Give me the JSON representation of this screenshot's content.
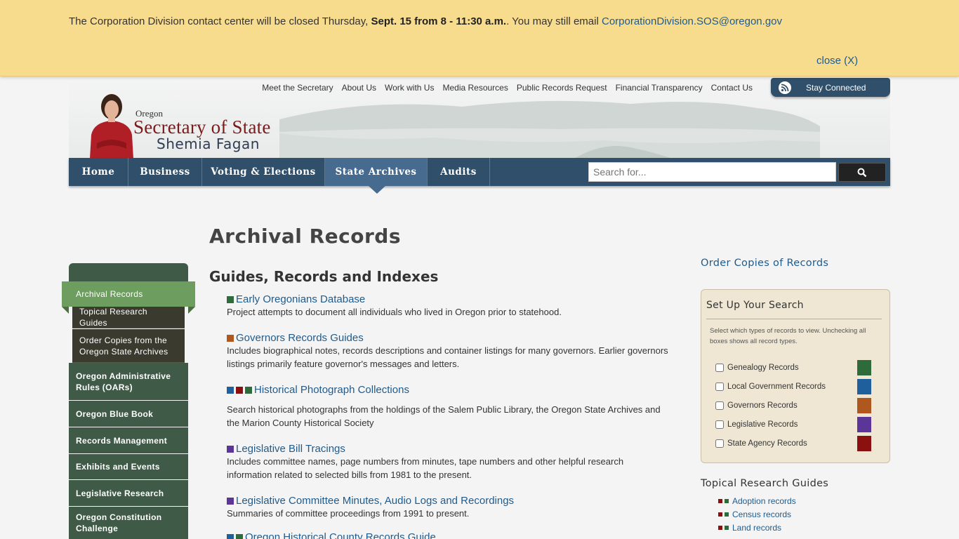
{
  "alert": {
    "text_before": "The Corporation Division contact center will be closed Thursday, ",
    "text_bold": "Sept. 15 from 8 - 11:30 a.m.",
    "text_after": ". You may still email ",
    "email": "CorporationDivision.SOS@oregon.gov",
    "close_label": "close (X)"
  },
  "header": {
    "top_links": [
      "Meet the Secretary",
      "About Us",
      "Work with Us",
      "Media Resources",
      "Public Records Request",
      "Financial Transparency",
      "Contact Us"
    ],
    "stay_connected": "Stay Connected",
    "logo": {
      "state": "Oregon",
      "title": "Secretary of State",
      "name": "Shemia Fagan"
    }
  },
  "nav": {
    "items": [
      "Home",
      "Business",
      "Voting & Elections",
      "State Archives",
      "Audits"
    ],
    "active": "State Archives",
    "search_placeholder": "Search for..."
  },
  "sidebar": {
    "active": "Archival Records",
    "sub_items": [
      "Topical Research Guides",
      "Order Copies from the Oregon State Archives"
    ],
    "items": [
      "Oregon Administrative Rules (OARs)",
      "Oregon Blue Book",
      "Records Management",
      "Exhibits and Events",
      "Legislative Research",
      "Oregon Constitution Challenge"
    ]
  },
  "main": {
    "title": "Archival Records",
    "section_title": "Guides, Records and Indexes",
    "entries": [
      {
        "title": "Early Oregonians Database",
        "desc": "Project attempts to document all individuals who lived in Oregon prior to statehood.",
        "colors": [
          "#2e6b3a"
        ]
      },
      {
        "title": "Governors Records Guides",
        "desc": "Includes biographical notes, records descriptions and container listings for many governors. Earlier governors listings primarily feature governor's messages and letters.",
        "colors": [
          "#b0571f"
        ]
      },
      {
        "title": "Historical Photograph Collections",
        "desc": "Search historical photographs from the holdings of the Salem Public Library, the Oregon State Archives and the Marion County Historical Society",
        "colors": [
          "#1f5f9c",
          "#8b1111",
          "#2e6b3a"
        ]
      },
      {
        "title": "Legislative Bill Tracings",
        "desc": "Includes committee names, page numbers from minutes, tape numbers and other helpful research information related to selected bills from 1981 to the present.",
        "colors": [
          "#5b3597"
        ]
      },
      {
        "title": "Legislative Committee Minutes, Audio Logs and Recordings",
        "desc": "Summaries of committee proceedings from 1991 to present.",
        "colors": [
          "#5b3597"
        ]
      },
      {
        "title": "Oregon Historical County Records Guide",
        "desc": "",
        "colors": [
          "#1f5f9c",
          "#2e6b3a"
        ]
      }
    ]
  },
  "right": {
    "order_link": "Order Copies of Records",
    "search_box": {
      "title": "Set Up Your Search",
      "note": "Select which types of records to view. Unchecking all boxes shows all record types.",
      "options": [
        {
          "label": "Genealogy Records",
          "color": "#2e6b3a"
        },
        {
          "label": "Local Government Records",
          "color": "#1f5f9c"
        },
        {
          "label": "Governors Records",
          "color": "#b0571f"
        },
        {
          "label": "Legislative Records",
          "color": "#5b3597"
        },
        {
          "label": "State Agency Records",
          "color": "#8b1111"
        }
      ]
    },
    "topical_title": "Topical Research Guides",
    "topical_items": [
      "Adoption records",
      "Census records",
      "Land records"
    ]
  }
}
